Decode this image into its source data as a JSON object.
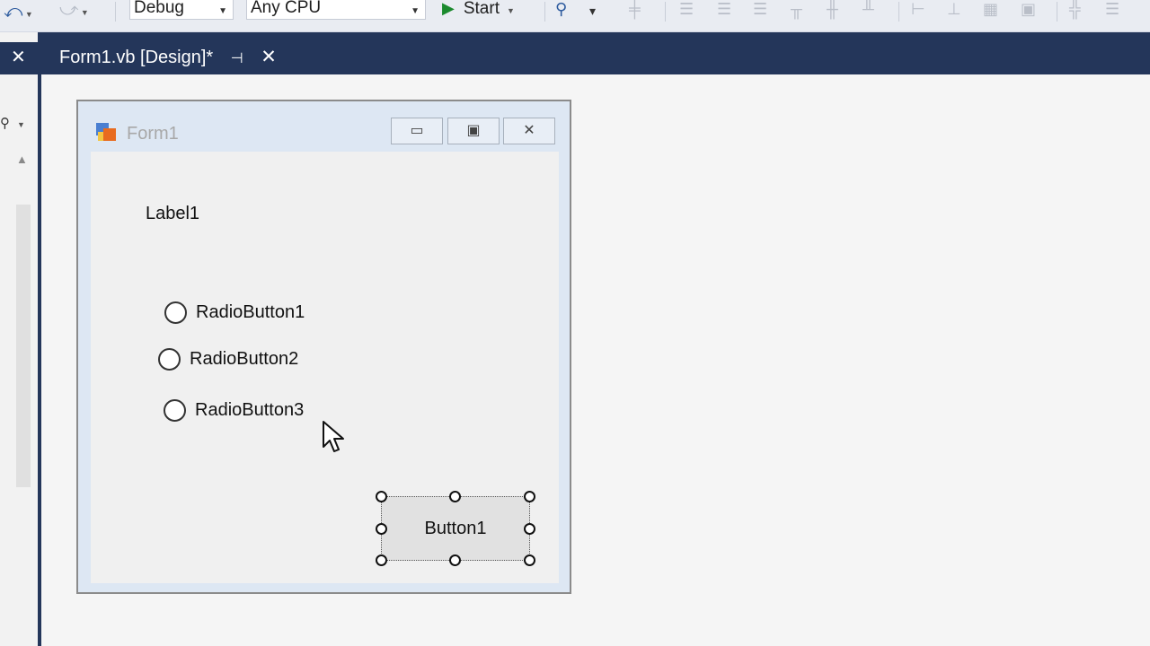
{
  "toolbar": {
    "configuration": "Debug",
    "platform": "Any CPU",
    "start_label": "Start"
  },
  "document_tab": {
    "title": "Form1.vb [Design]*",
    "pin_icon": "⊣",
    "close_icon": "✕"
  },
  "left_panel": {
    "close_icon": "✕",
    "search_icon": "⚲"
  },
  "form": {
    "title": "Form1",
    "label1": "Label1",
    "radio_buttons": [
      "RadioButton1",
      "RadioButton2",
      "RadioButton3"
    ],
    "button1": "Button1"
  }
}
